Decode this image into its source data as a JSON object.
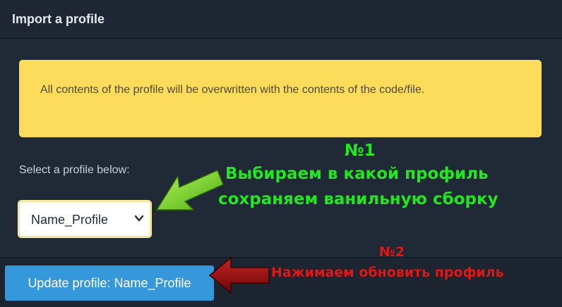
{
  "dialog": {
    "title": "Import a profile",
    "warning": "All contents of the profile will be overwritten with the contents of the code/file.",
    "select_label": "Select a profile below:",
    "selected_profile": "Name_Profile",
    "update_button_label": "Update profile: Name_Profile"
  },
  "annotations": {
    "step1_number": "№1",
    "step1_line1": "Выбираем в какой профиль",
    "step1_line2": "сохраняем ванильную сборку",
    "step2_number": "№2",
    "step2_text": "Нажимаем обновить профиль"
  },
  "icons": {
    "select_chevron": "chevron-down-icon",
    "arrow_green": "arrow-left-icon",
    "arrow_red": "arrow-left-icon"
  },
  "colors": {
    "background": "#202a37",
    "alert": "#fcdc5a",
    "button": "#3498db",
    "annotation_green": "#22e822",
    "annotation_red": "#e01818"
  }
}
